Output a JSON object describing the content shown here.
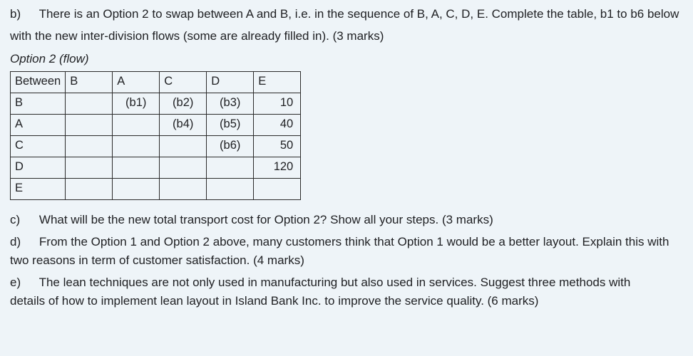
{
  "q_b": {
    "label": "b)",
    "text_line1": "There is an Option 2 to swap between A and B, i.e. in the sequence of B, A, C, D, E. Complete the table, b1 to b6 below",
    "text_line2": "with the new inter-division flows (some are already filled in). (3 marks)"
  },
  "caption": "Option 2 (flow)",
  "table": {
    "corner": "Between",
    "cols": [
      "B",
      "A",
      "C",
      "D",
      "E"
    ],
    "rows": [
      {
        "name": "B",
        "cells": [
          "",
          "(b1)",
          "(b2)",
          "(b3)",
          "10"
        ]
      },
      {
        "name": "A",
        "cells": [
          "",
          "",
          "(b4)",
          "(b5)",
          "40"
        ]
      },
      {
        "name": "C",
        "cells": [
          "",
          "",
          "",
          "(b6)",
          "50"
        ]
      },
      {
        "name": "D",
        "cells": [
          "",
          "",
          "",
          "",
          "120"
        ]
      },
      {
        "name": "E",
        "cells": [
          "",
          "",
          "",
          "",
          ""
        ]
      }
    ]
  },
  "q_c": {
    "label": "c)",
    "text": "What will be the new total transport cost for Option 2? Show all your steps. (3 marks)"
  },
  "q_d": {
    "label": "d)",
    "text_line1": "From the Option 1 and Option 2 above, many customers think that Option 1 would be a better layout. Explain this with",
    "text_line2": "two reasons in term of customer satisfaction. (4 marks)"
  },
  "q_e": {
    "label": "e)",
    "text_line1": "The lean techniques are not only used in manufacturing but also used in services. Suggest three methods with",
    "text_line2": "details of how to implement lean layout in Island Bank Inc. to improve the service quality. (6 marks)"
  }
}
